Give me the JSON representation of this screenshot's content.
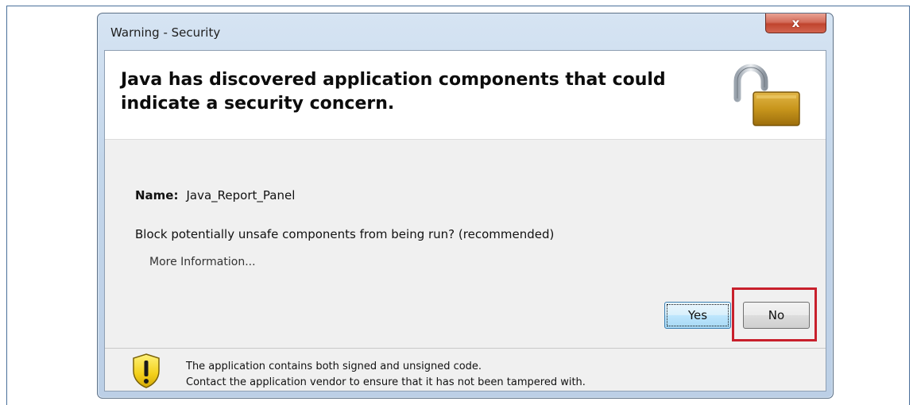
{
  "window": {
    "title": "Warning - Security",
    "close_label": "x"
  },
  "header": {
    "message": "Java has discovered application components that could indicate a security concern.",
    "icon": "unlocked-padlock-icon"
  },
  "details": {
    "name_label": "Name:",
    "name_value": "Java_Report_Panel",
    "question": "Block potentially unsafe components from being run? (recommended)",
    "more_info_link": "More Information..."
  },
  "buttons": {
    "yes_label": "Yes",
    "no_label": "No"
  },
  "footer": {
    "icon": "warning-shield-icon",
    "line1": "The application contains both signed and unsigned code.",
    "line2": "Contact the application vendor to ensure that it has not been tampered with."
  },
  "colors": {
    "highlight": "#c8202c",
    "lock_body": "#c8961c",
    "warning_yellow": "#f3d01a"
  }
}
